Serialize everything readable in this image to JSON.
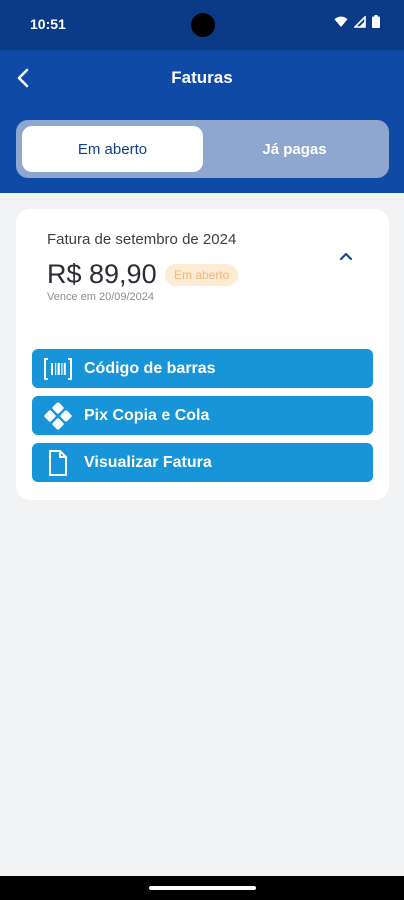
{
  "status_bar": {
    "time": "10:51"
  },
  "header": {
    "title": "Faturas"
  },
  "tabs": [
    {
      "label": "Em aberto",
      "active": true
    },
    {
      "label": "Já pagas",
      "active": false
    }
  ],
  "invoice": {
    "title": "Fatura de setembro de 2024",
    "amount": "R$ 89,90",
    "status": "Em aberto",
    "due": "Vence em 20/09/2024"
  },
  "actions": {
    "barcode": "Código de barras",
    "pix": "Pix Copia e Cola",
    "view": "Visualizar Fatura"
  },
  "colors": {
    "status_bar": "#0b3a86",
    "header": "#0f4aa6",
    "button": "#1795d8",
    "badge_bg": "#fdebd3",
    "badge_text": "#f3b67b",
    "background": "#f1f3f5"
  },
  "icons": {
    "back": "chevron-left-icon",
    "collapse": "chevron-up-icon",
    "barcode": "barcode-icon",
    "pix": "pix-icon",
    "view": "document-icon",
    "wifi": "wifi-icon",
    "signal": "signal-icon",
    "battery": "battery-icon"
  }
}
